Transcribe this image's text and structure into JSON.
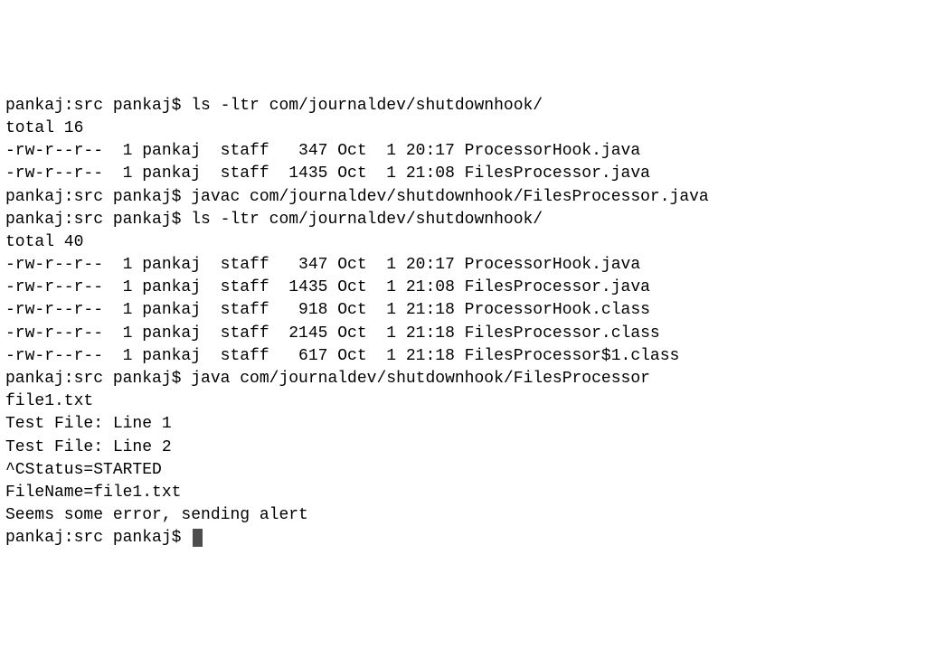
{
  "lines": [
    "pankaj:src pankaj$ ls -ltr com/journaldev/shutdownhook/",
    "total 16",
    "-rw-r--r--  1 pankaj  staff   347 Oct  1 20:17 ProcessorHook.java",
    "-rw-r--r--  1 pankaj  staff  1435 Oct  1 21:08 FilesProcessor.java",
    "pankaj:src pankaj$ javac com/journaldev/shutdownhook/FilesProcessor.java",
    "pankaj:src pankaj$ ls -ltr com/journaldev/shutdownhook/",
    "total 40",
    "-rw-r--r--  1 pankaj  staff   347 Oct  1 20:17 ProcessorHook.java",
    "-rw-r--r--  1 pankaj  staff  1435 Oct  1 21:08 FilesProcessor.java",
    "-rw-r--r--  1 pankaj  staff   918 Oct  1 21:18 ProcessorHook.class",
    "-rw-r--r--  1 pankaj  staff  2145 Oct  1 21:18 FilesProcessor.class",
    "-rw-r--r--  1 pankaj  staff   617 Oct  1 21:18 FilesProcessor$1.class",
    "pankaj:src pankaj$ java com/journaldev/shutdownhook/FilesProcessor",
    "file1.txt",
    "Test File: Line 1",
    "Test File: Line 2",
    "^CStatus=STARTED",
    "FileName=file1.txt",
    "Seems some error, sending alert",
    "pankaj:src pankaj$ "
  ]
}
